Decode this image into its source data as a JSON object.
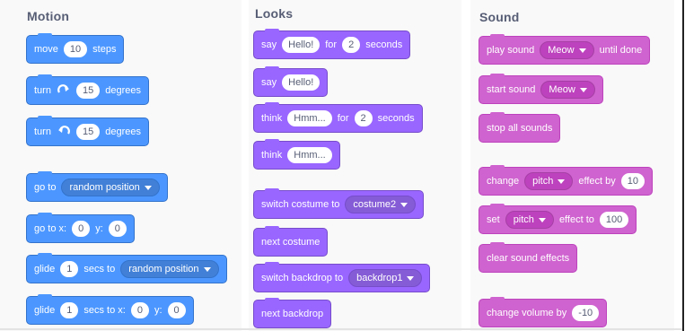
{
  "motion": {
    "title": "Motion",
    "move": {
      "pre": "move",
      "steps": "10",
      "post": "steps"
    },
    "turn_right": {
      "pre": "turn",
      "degrees": "15",
      "post": "degrees"
    },
    "turn_left": {
      "pre": "turn",
      "degrees": "15",
      "post": "degrees"
    },
    "goto": {
      "pre": "go to",
      "target": "random position"
    },
    "goto_xy": {
      "pre": "go to x:",
      "x": "0",
      "ylabel": "y:",
      "y": "0"
    },
    "glide_to": {
      "pre": "glide",
      "secs": "1",
      "mid": "secs to",
      "target": "random position"
    },
    "glide_xy": {
      "pre": "glide",
      "secs": "1",
      "mid": "secs to x:",
      "x": "0",
      "ylabel": "y:",
      "y": "0"
    }
  },
  "looks": {
    "title": "Looks",
    "say_for": {
      "pre": "say",
      "text": "Hello!",
      "mid": "for",
      "secs": "2",
      "post": "seconds"
    },
    "say": {
      "pre": "say",
      "text": "Hello!"
    },
    "think_for": {
      "pre": "think",
      "text": "Hmm...",
      "mid": "for",
      "secs": "2",
      "post": "seconds"
    },
    "think": {
      "pre": "think",
      "text": "Hmm..."
    },
    "switch_costume": {
      "pre": "switch costume to",
      "value": "costume2"
    },
    "next_costume": {
      "label": "next costume"
    },
    "switch_backdrop": {
      "pre": "switch backdrop to",
      "value": "backdrop1"
    },
    "next_backdrop": {
      "label": "next backdrop"
    }
  },
  "sound": {
    "title": "Sound",
    "play_until_done": {
      "pre": "play sound",
      "value": "Meow",
      "post": "until done"
    },
    "start_sound": {
      "pre": "start sound",
      "value": "Meow"
    },
    "stop_all": {
      "label": "stop all sounds"
    },
    "change_effect": {
      "pre": "change",
      "effect": "pitch",
      "mid": "effect by",
      "value": "10"
    },
    "set_effect": {
      "pre": "set",
      "effect": "pitch",
      "mid": "effect to",
      "value": "100"
    },
    "clear_effects": {
      "label": "clear sound effects"
    },
    "change_volume": {
      "pre": "change volume by",
      "value": "-10"
    }
  },
  "colors": {
    "motion": "#4c97ff",
    "looks": "#9966ff",
    "sound": "#cf63cf",
    "panel_bg": "#f9f9f9",
    "title_text": "#575e75"
  },
  "icons": {
    "turn_right": "rotate-clockwise-icon",
    "turn_left": "rotate-counterclockwise-icon",
    "dropdown": "caret-down-icon"
  }
}
